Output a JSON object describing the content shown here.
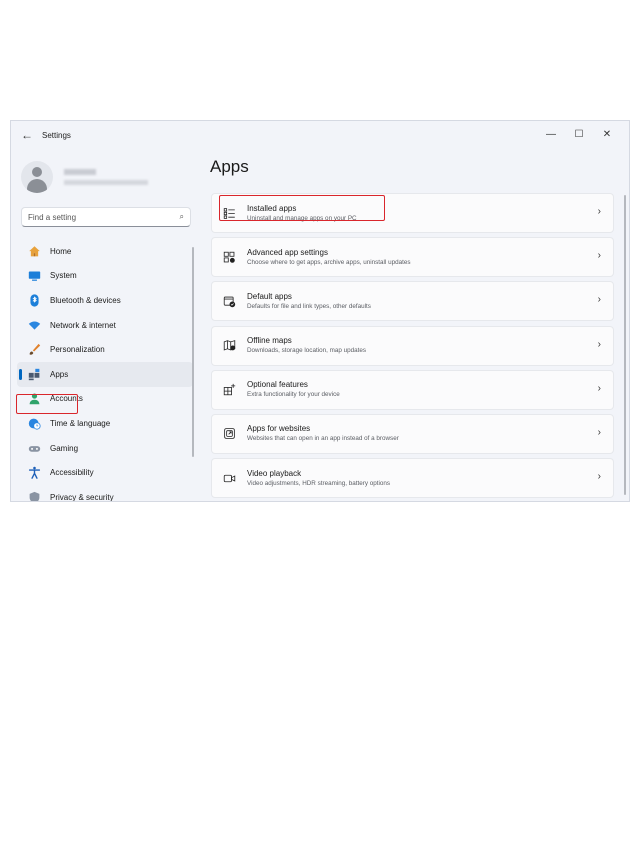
{
  "window": {
    "title": "Settings",
    "back_glyph": "←",
    "controls": {
      "minimize": "—",
      "maximize": "☐",
      "close": "✕"
    }
  },
  "search": {
    "placeholder": "Find a setting",
    "icon": "⌕"
  },
  "sidebar": {
    "items": [
      {
        "label": "Home",
        "icon": "home-icon"
      },
      {
        "label": "System",
        "icon": "system-icon"
      },
      {
        "label": "Bluetooth & devices",
        "icon": "bluetooth-icon"
      },
      {
        "label": "Network & internet",
        "icon": "wifi-icon"
      },
      {
        "label": "Personalization",
        "icon": "brush-icon"
      },
      {
        "label": "Apps",
        "icon": "apps-icon",
        "active": true
      },
      {
        "label": "Accounts",
        "icon": "person-icon"
      },
      {
        "label": "Time & language",
        "icon": "globe-clock-icon"
      },
      {
        "label": "Gaming",
        "icon": "gamepad-icon"
      },
      {
        "label": "Accessibility",
        "icon": "accessibility-icon"
      },
      {
        "label": "Privacy & security",
        "icon": "shield-icon"
      }
    ]
  },
  "main": {
    "title": "Apps",
    "cards": [
      {
        "title": "Installed apps",
        "subtitle": "Uninstall and manage apps on your PC",
        "icon": "list-icon"
      },
      {
        "title": "Advanced app settings",
        "subtitle": "Choose where to get apps, archive apps, uninstall updates",
        "icon": "app-settings-icon"
      },
      {
        "title": "Default apps",
        "subtitle": "Defaults for file and link types, other defaults",
        "icon": "default-apps-icon"
      },
      {
        "title": "Offline maps",
        "subtitle": "Downloads, storage location, map updates",
        "icon": "map-icon"
      },
      {
        "title": "Optional features",
        "subtitle": "Extra functionality for your device",
        "icon": "grid-plus-icon"
      },
      {
        "title": "Apps for websites",
        "subtitle": "Websites that can open in an app instead of a browser",
        "icon": "link-app-icon"
      },
      {
        "title": "Video playback",
        "subtitle": "Video adjustments, HDR streaming, battery options",
        "icon": "video-icon"
      }
    ],
    "chevron": "›"
  },
  "colors": {
    "accent": "#0067c0",
    "highlight": "#d9262c",
    "background": "#f2f4f9",
    "card": "#fbfbfc"
  }
}
